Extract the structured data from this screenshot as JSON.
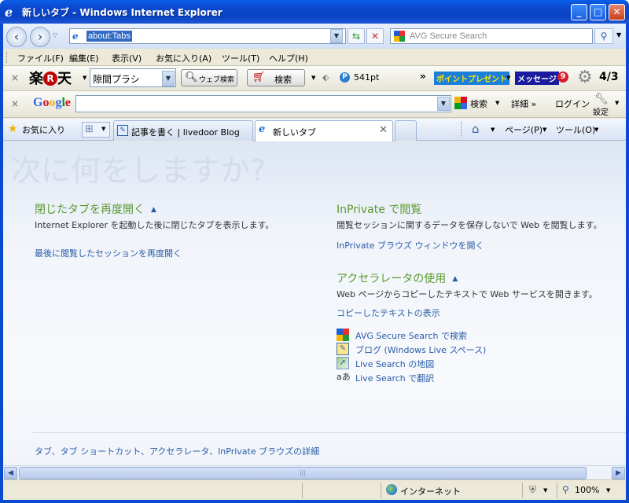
{
  "window": {
    "title": "新しいタブ - Windows Internet Explorer",
    "minimize": "_",
    "maximize": "□",
    "close": "✕"
  },
  "address": {
    "url": "about:Tabs",
    "search_placeholder": "AVG Secure Search"
  },
  "menu": [
    "ファイル(F)",
    "編集(E)",
    "表示(V)",
    "お気に入り(A)",
    "ツール(T)",
    "ヘルプ(H)"
  ],
  "rakuten_toolbar": {
    "logo_left": "楽",
    "logo_circle": "R",
    "logo_right": "天",
    "select_value": "隙間プラシ",
    "web_search": "ウェブ検索",
    "search": "検索",
    "points": "541pt",
    "point_present": "ポイントプレゼント",
    "message": "メッセージ",
    "message_count": "9",
    "date": "4/3"
  },
  "google_toolbar": {
    "logo": "Google",
    "search": "検索",
    "details": "詳細 »",
    "login": "ログイン",
    "settings": "設定"
  },
  "tabbar": {
    "favorites": "お気に入り",
    "tabs": [
      {
        "label": "記事を書く | livedoor Blog",
        "active": false
      },
      {
        "label": "新しいタブ",
        "active": true
      }
    ],
    "page_menu": "ページ(P)",
    "tools_menu": "ツール(O)"
  },
  "content": {
    "headline": "次に何をしますか?",
    "reopen": {
      "title": "閉じたタブを再度開く",
      "desc": "Internet Explorer を起動した後に閉じたタブを表示します。",
      "link": "最後に閲覧したセッションを再度開く"
    },
    "inprivate": {
      "title": "InPrivate で閲覧",
      "desc": "閲覧セッションに関するデータを保存しないで Web を閲覧します。",
      "link": "InPrivate ブラウズ ウィンドウを開く"
    },
    "accelerators": {
      "title": "アクセラレータの使用",
      "desc": "Web ページからコピーしたテキストで Web サービスを開きます。",
      "link": "コピーしたテキストの表示",
      "items": [
        {
          "label": "AVG Secure Search で検索",
          "icon": "avg-icon"
        },
        {
          "label": "ブログ (Windows Live スペース)",
          "icon": "blog-icon"
        },
        {
          "label": "Live Search の地図",
          "icon": "map-icon"
        },
        {
          "label": "Live Search で翻訳",
          "icon": "translate-icon"
        }
      ]
    },
    "footer_link": "タブ、タブ ショートカット、アクセラレータ、InPrivate ブラウズの詳細"
  },
  "status": {
    "zone": "インターネット",
    "zoom": "100%"
  },
  "colors": {
    "title_bar": "#0a4ad0",
    "section_title": "#5a9a2e",
    "link": "#2a5ca8",
    "headline": "#d3dcec"
  }
}
